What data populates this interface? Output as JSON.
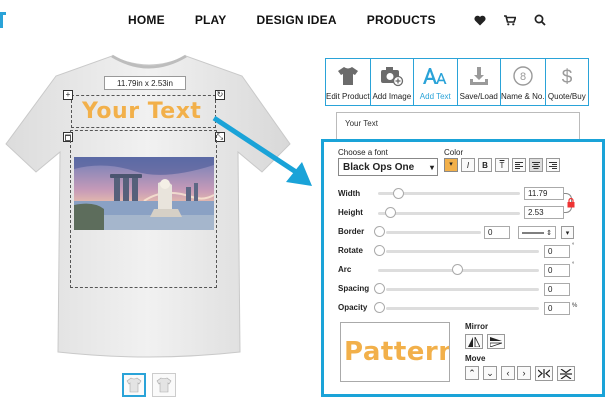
{
  "nav": {
    "items": [
      "HOME",
      "PLAY",
      "DESIGN IDEA",
      "PRODUCTS"
    ],
    "icons": [
      "heart-icon",
      "cart-icon",
      "search-icon"
    ]
  },
  "canvas": {
    "size_label": "11.79in x 2.53in",
    "design_text": "Your Text"
  },
  "tabs": [
    {
      "label": "Edit Product",
      "icon": "shirt-icon"
    },
    {
      "label": "Add Image",
      "icon": "camera-add-icon"
    },
    {
      "label": "Add Text",
      "icon": "text-aa-icon"
    },
    {
      "label": "Save/Load",
      "icon": "download-tray-icon"
    },
    {
      "label": "Name & No.",
      "icon": "number-circle-icon"
    },
    {
      "label": "Quote/Buy",
      "icon": "dollar-icon"
    }
  ],
  "text_input": {
    "value": "Your Text"
  },
  "panel": {
    "font_label": "Choose a font",
    "font_value": "Black Ops One",
    "color_label": "Color",
    "width_label": "Width",
    "width_value": "11.79",
    "height_label": "Height",
    "height_value": "2.53",
    "border_label": "Border",
    "border_value": "0",
    "rotate_label": "Rotate",
    "rotate_value": "0",
    "arc_label": "Arc",
    "arc_value": "0",
    "spacing_label": "Spacing",
    "spacing_value": "0",
    "opacity_label": "Opacity",
    "opacity_value": "0",
    "degree_unit": "°",
    "percent_unit": "%",
    "mirror_label": "Mirror",
    "move_label": "Move",
    "preview_text": "Pattern"
  },
  "colors": {
    "accent": "#1aa3d8",
    "text_fill": "#f2b04a"
  }
}
